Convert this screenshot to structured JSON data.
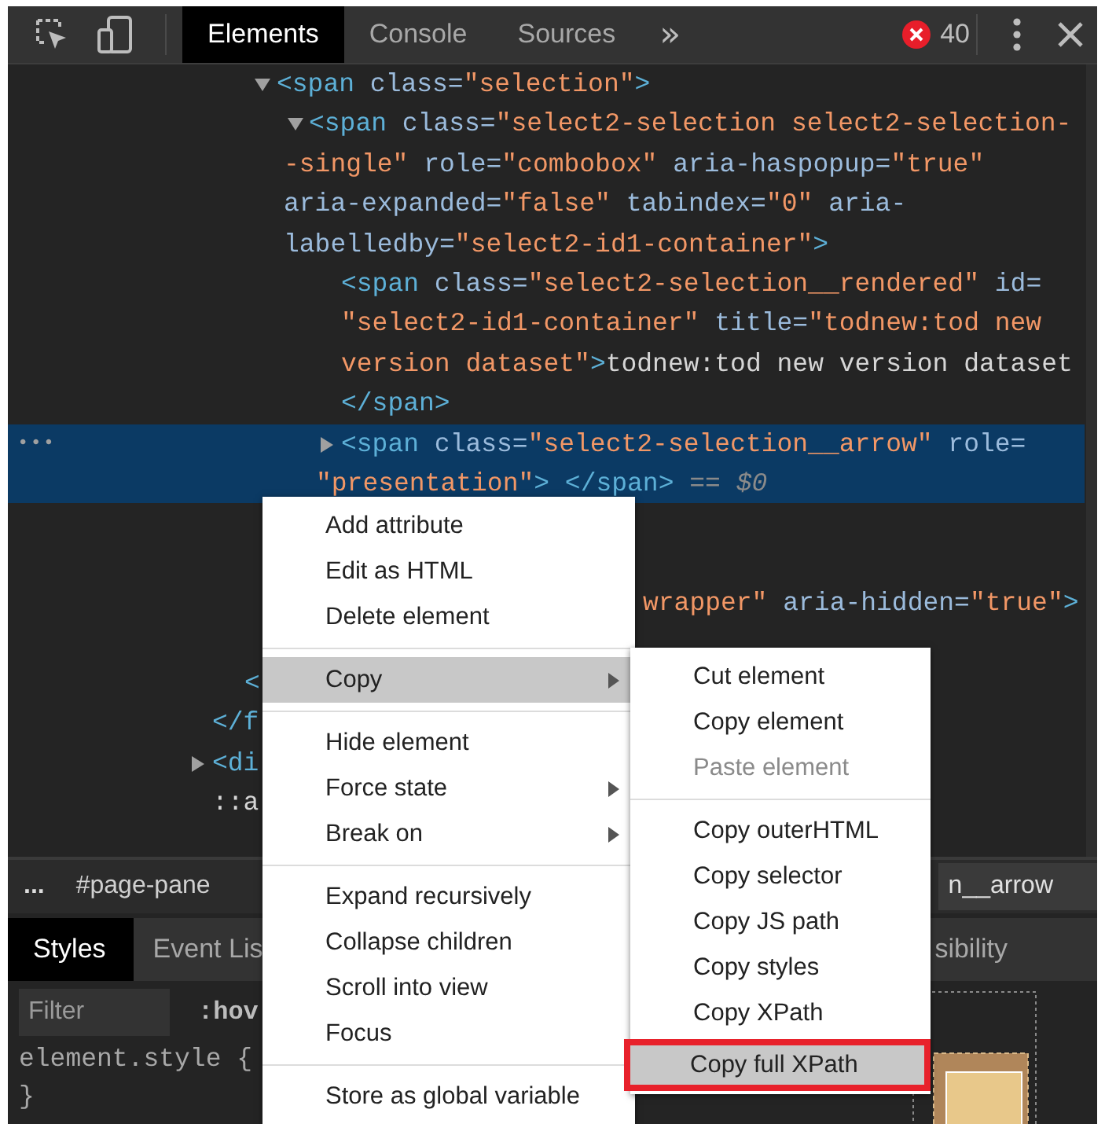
{
  "toolbar": {
    "tabs": [
      {
        "label": "Elements",
        "selected": true
      },
      {
        "label": "Console",
        "selected": false
      },
      {
        "label": "Sources",
        "selected": false
      }
    ],
    "more_tabs": "»",
    "error_count": "40"
  },
  "dom_tree": [
    {
      "children": [
        {
          "children": [
            {
              "expanded": true,
              "selected": false,
              "lines": [
                [
                  {
                    "kind": "tag",
                    "text": "<span"
                  },
                  {
                    "kind": "attr",
                    "text": " class="
                  },
                  {
                    "kind": "value",
                    "text": "\"selection\""
                  },
                  {
                    "kind": "tag",
                    "text": ">"
                  }
                ]
              ],
              "children": [
                {
                  "expanded": true,
                  "selected": false,
                  "lines": [
                    [
                      {
                        "kind": "tag",
                        "text": "<span"
                      },
                      {
                        "kind": "attr",
                        "text": " class="
                      },
                      {
                        "kind": "value",
                        "text": "\"select2-selection select2-selection-"
                      }
                    ],
                    [
                      {
                        "kind": "value",
                        "text": "-single\""
                      },
                      {
                        "kind": "attr",
                        "text": " role="
                      },
                      {
                        "kind": "value",
                        "text": "\"combobox\""
                      },
                      {
                        "kind": "attr",
                        "text": " aria-haspopup="
                      },
                      {
                        "kind": "value",
                        "text": "\"true\""
                      }
                    ],
                    [
                      {
                        "kind": "attr",
                        "text": "aria-expanded="
                      },
                      {
                        "kind": "value",
                        "text": "\"false\""
                      },
                      {
                        "kind": "attr",
                        "text": " tabindex="
                      },
                      {
                        "kind": "value",
                        "text": "\"0\""
                      },
                      {
                        "kind": "attr",
                        "text": " aria-"
                      }
                    ],
                    [
                      {
                        "kind": "attr",
                        "text": "labelledby="
                      },
                      {
                        "kind": "value",
                        "text": "\"select2-id1-container\""
                      },
                      {
                        "kind": "tag",
                        "text": ">"
                      }
                    ]
                  ],
                  "children": [
                    {
                      "selected": false,
                      "lines": [
                        [
                          {
                            "kind": "tag",
                            "text": "<span"
                          },
                          {
                            "kind": "attr",
                            "text": " class="
                          },
                          {
                            "kind": "value",
                            "text": "\"select2-selection__rendered\""
                          },
                          {
                            "kind": "attr",
                            "text": " id="
                          }
                        ],
                        [
                          {
                            "kind": "value",
                            "text": "\"select2-id1-container\""
                          },
                          {
                            "kind": "attr",
                            "text": " title="
                          },
                          {
                            "kind": "value",
                            "text": "\"todnew:tod new"
                          }
                        ],
                        [
                          {
                            "kind": "value",
                            "text": "version dataset\""
                          },
                          {
                            "kind": "tag",
                            "text": ">"
                          },
                          {
                            "kind": "text",
                            "text": "todnew:tod new version dataset"
                          }
                        ],
                        [
                          {
                            "kind": "tag",
                            "text": "</span>"
                          }
                        ]
                      ]
                    },
                    {
                      "expanded": false,
                      "selected": true,
                      "gutter": "•••",
                      "lines": [
                        [
                          {
                            "kind": "tag",
                            "text": "<span"
                          },
                          {
                            "kind": "attr",
                            "text": " class="
                          },
                          {
                            "kind": "value",
                            "text": "\"select2-selection__arrow\""
                          },
                          {
                            "kind": "attr",
                            "text": " role="
                          }
                        ],
                        [
                          {
                            "kind": "value",
                            "text": "\"presentation\""
                          },
                          {
                            "kind": "tag",
                            "text": "> </span>"
                          },
                          {
                            "kind": "ref",
                            "text": " == $0"
                          }
                        ]
                      ]
                    },
                    {
                      "selected": false,
                      "clipped": true,
                      "lines": [
                        [
                          {
                            "kind": "value",
                            "text": "wrapper\""
                          },
                          {
                            "kind": "attr",
                            "text": " aria-hidden="
                          },
                          {
                            "kind": "value",
                            "text": "\"true\""
                          },
                          {
                            "kind": "tag",
                            "text": ">"
                          }
                        ]
                      ]
                    }
                  ]
                }
              ]
            }
          ]
        },
        {
          "selected": false,
          "lines": [
            [
              {
                "kind": "tag",
                "text": "<"
              }
            ]
          ]
        }
      ],
      "close": [
        {
          "kind": "tag",
          "text": "</f"
        }
      ]
    },
    {
      "expanded": false,
      "selected": false,
      "lines": [
        [
          {
            "kind": "tag",
            "text": "<di"
          }
        ]
      ]
    },
    {
      "selected": false,
      "lines": [
        [
          {
            "kind": "text",
            "text": "::a"
          }
        ]
      ]
    }
  ],
  "breadcrumbs": {
    "ellipsis": "...",
    "items": [
      {
        "label": "#page-pane",
        "selected": false
      },
      {
        "label": "n__arrow",
        "selected": true
      }
    ]
  },
  "styles_tabs": [
    {
      "label": "Styles",
      "selected": true
    },
    {
      "label": "Event Lis",
      "selected": false
    },
    {
      "label": "sibility",
      "selected": false
    }
  ],
  "filter": {
    "placeholder": "Filter",
    "hov": ":hov"
  },
  "styles_lines": [
    "element.style {",
    "}"
  ],
  "context_menu": [
    {
      "kind": "item",
      "label": "Add attribute",
      "selected": false,
      "submenu": false
    },
    {
      "kind": "item",
      "label": "Edit as HTML",
      "selected": false,
      "submenu": false
    },
    {
      "kind": "item",
      "label": "Delete element",
      "selected": false,
      "submenu": false
    },
    {
      "kind": "separator"
    },
    {
      "kind": "item",
      "label": "Copy",
      "selected": true,
      "submenu": true
    },
    {
      "kind": "separator"
    },
    {
      "kind": "item",
      "label": "Hide element",
      "selected": false,
      "submenu": false
    },
    {
      "kind": "item",
      "label": "Force state",
      "selected": false,
      "submenu": true
    },
    {
      "kind": "item",
      "label": "Break on",
      "selected": false,
      "submenu": true
    },
    {
      "kind": "separator"
    },
    {
      "kind": "item",
      "label": "Expand recursively",
      "selected": false,
      "submenu": false
    },
    {
      "kind": "item",
      "label": "Collapse children",
      "selected": false,
      "submenu": false
    },
    {
      "kind": "item",
      "label": "Scroll into view",
      "selected": false,
      "submenu": false
    },
    {
      "kind": "item",
      "label": "Focus",
      "selected": false,
      "submenu": false
    },
    {
      "kind": "separator"
    },
    {
      "kind": "item",
      "label": "Store as global variable",
      "selected": false,
      "submenu": false
    }
  ],
  "copy_submenu": [
    {
      "kind": "item",
      "label": "Cut element",
      "selected": false,
      "disabled": false,
      "outlined": false
    },
    {
      "kind": "item",
      "label": "Copy element",
      "selected": false,
      "disabled": false,
      "outlined": false
    },
    {
      "kind": "item",
      "label": "Paste element",
      "selected": false,
      "disabled": true,
      "outlined": false
    },
    {
      "kind": "separator"
    },
    {
      "kind": "item",
      "label": "Copy outerHTML",
      "selected": false,
      "disabled": false,
      "outlined": false
    },
    {
      "kind": "item",
      "label": "Copy selector",
      "selected": false,
      "disabled": false,
      "outlined": false
    },
    {
      "kind": "item",
      "label": "Copy JS path",
      "selected": false,
      "disabled": false,
      "outlined": false
    },
    {
      "kind": "item",
      "label": "Copy styles",
      "selected": false,
      "disabled": false,
      "outlined": false
    },
    {
      "kind": "item",
      "label": "Copy XPath",
      "selected": false,
      "disabled": false,
      "outlined": false
    },
    {
      "kind": "item",
      "label": "Copy full XPath",
      "selected": true,
      "disabled": false,
      "outlined": true
    }
  ]
}
